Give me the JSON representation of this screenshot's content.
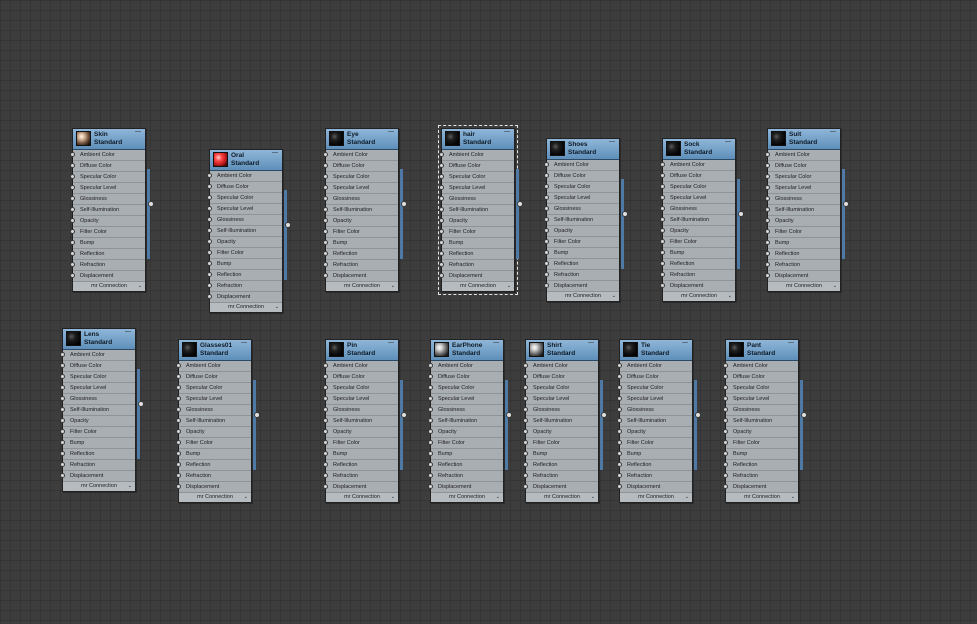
{
  "slot_labels": [
    "Ambient Color",
    "Diffuse Color",
    "Specular Color",
    "Specular Level",
    "Glossiness",
    "Self-Illumination",
    "Opacity",
    "Filter Color",
    "Bump",
    "Reflection",
    "Refraction",
    "Displacement"
  ],
  "footer_label": "mr Connection",
  "collapse_glyph": "—",
  "footer_glyph": "⌄",
  "nodes": [
    {
      "name": "Skin",
      "type": "Standard",
      "thumb": "sphere-skin",
      "selected": false
    },
    {
      "name": "Oral",
      "type": "Standard",
      "thumb": "sphere-red",
      "selected": false
    },
    {
      "name": "Eye",
      "type": "Standard",
      "thumb": "sphere-black",
      "selected": false
    },
    {
      "name": "hair",
      "type": "Standard",
      "thumb": "sphere-black",
      "selected": true
    },
    {
      "name": "Shoes",
      "type": "Standard",
      "thumb": "sphere-black",
      "selected": false
    },
    {
      "name": "Sock",
      "type": "Standard",
      "thumb": "sphere-black",
      "selected": false
    },
    {
      "name": "Suit",
      "type": "Standard",
      "thumb": "sphere-black",
      "selected": false
    },
    {
      "name": "Lens",
      "type": "Standard",
      "thumb": "sphere-black",
      "selected": false
    },
    {
      "name": "Glasses01",
      "type": "Standard",
      "thumb": "sphere-black",
      "selected": false
    },
    {
      "name": "Pin",
      "type": "Standard",
      "thumb": "sphere-black",
      "selected": false
    },
    {
      "name": "EarPhone",
      "type": "Standard",
      "thumb": "sphere-gray",
      "selected": false
    },
    {
      "name": "Shirt",
      "type": "Standard",
      "thumb": "sphere-gray",
      "selected": false
    },
    {
      "name": "Tie",
      "type": "Standard",
      "thumb": "sphere-black",
      "selected": false
    },
    {
      "name": "Pant",
      "type": "Standard",
      "thumb": "sphere-black",
      "selected": false
    }
  ]
}
